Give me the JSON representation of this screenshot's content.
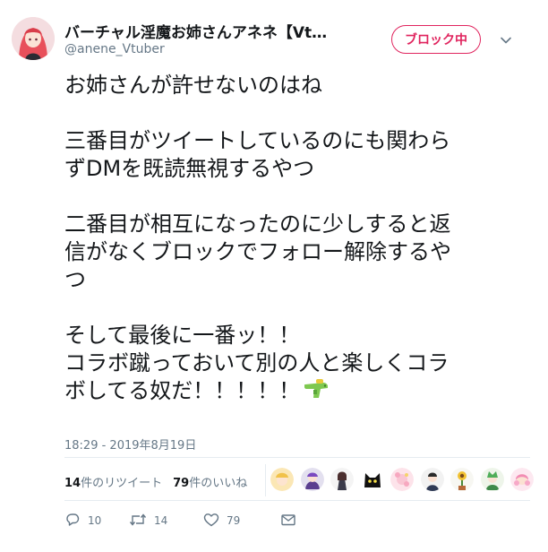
{
  "user": {
    "display_name": "バーチャル淫魔お姉さんアネネ【Vt…",
    "handle": "@anene_Vtuber"
  },
  "follow_button": {
    "label": "ブロック中"
  },
  "tweet": {
    "paragraphs": [
      {
        "lines": [
          "お姉さんが許せないのはね"
        ]
      },
      {
        "lines": [
          "三番目がツイートしているのにも関わら",
          "ずDMを既読無視するやつ"
        ]
      },
      {
        "lines": [
          "二番目が相互になったのに少しすると返",
          "信がなくブロックでフォロー解除するや",
          "つ"
        ]
      },
      {
        "lines": [
          "そして最後に一番ッ！！",
          "コラボ蹴っておいて別の人と楽しくコラ",
          "ボしてる奴だ！！！！！"
        ]
      }
    ],
    "emoji": "water-pistol-icon",
    "timestamp": "18:29 - 2019年8月19日"
  },
  "stats": {
    "retweets_count": "14",
    "retweets_label": "件のリツイート",
    "likes_count": "79",
    "likes_label": "件のいいね",
    "liker_avatars": [
      "avatar-1",
      "avatar-2",
      "avatar-3",
      "avatar-4",
      "avatar-5",
      "avatar-6",
      "avatar-7",
      "avatar-8",
      "avatar-9"
    ]
  },
  "actions": {
    "reply_count": "10",
    "retweet_count": "14",
    "like_count": "79"
  },
  "colors": {
    "block_red": "#e0245e",
    "text": "#14171a",
    "secondary": "#657786",
    "divider": "#e6ecf0"
  }
}
